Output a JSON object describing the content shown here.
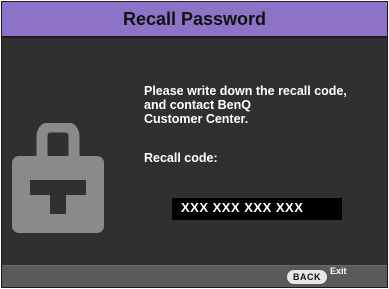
{
  "dialog": {
    "title": "Recall Password",
    "message_lines": [
      "Please write down the recall code,",
      "and contact BenQ",
      "Customer Center."
    ],
    "code_label": "Recall code:",
    "code_value": "XXX  XXX  XXX  XXX",
    "icon": "lock-icon"
  },
  "footer": {
    "back_label": "BACK",
    "exit_label": "Exit"
  },
  "colors": {
    "title_bar": "#8e72c7",
    "background": "#303030",
    "footer": "#5a5a5a",
    "lock_icon": "#8a8a8a"
  }
}
